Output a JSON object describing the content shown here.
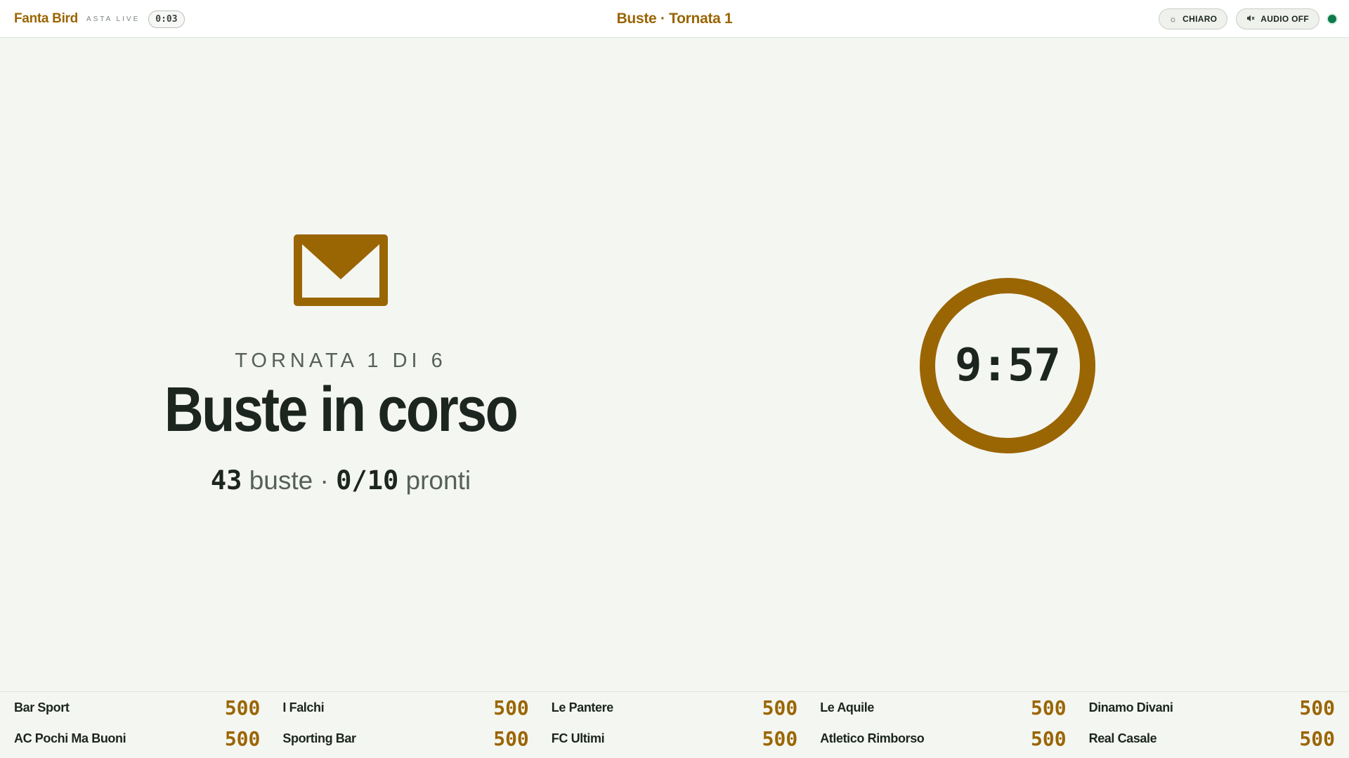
{
  "app": {
    "brand": "Fanta Bird",
    "subtitle": "ASTA LIVE",
    "elapsed": "0:03",
    "title": "Buste · Tornata 1"
  },
  "actions": {
    "theme_label": "CHIARO",
    "audio_label": "AUDIO OFF"
  },
  "hero": {
    "round_label": "TORNATA 1 DI 6",
    "headline": "Buste in corso",
    "envelopes_count": "43",
    "envelopes_label": "buste",
    "separator": "·",
    "ready_count": "0/10",
    "ready_label": "pronti"
  },
  "timer": {
    "display": "9:57",
    "remaining_fraction": 1.0
  },
  "standings": [
    {
      "name": "Bar Sport",
      "budget": "500"
    },
    {
      "name": "I Falchi",
      "budget": "500"
    },
    {
      "name": "Le Pantere",
      "budget": "500"
    },
    {
      "name": "Le Aquile",
      "budget": "500"
    },
    {
      "name": "Dinamo Divani",
      "budget": "500"
    },
    {
      "name": "AC Pochi Ma Buoni",
      "budget": "500"
    },
    {
      "name": "Sporting Bar",
      "budget": "500"
    },
    {
      "name": "FC Ultimi",
      "budget": "500"
    },
    {
      "name": "Atletico Rimborso",
      "budget": "500"
    },
    {
      "name": "Real Casale",
      "budget": "500"
    }
  ],
  "icons": {
    "theme": "sun-icon",
    "audio": "speaker-muted-icon",
    "hero": "envelope-icon"
  },
  "colors": {
    "accent": "#9a6503",
    "live": "#0f7a4a",
    "background": "#f4f6f1"
  }
}
